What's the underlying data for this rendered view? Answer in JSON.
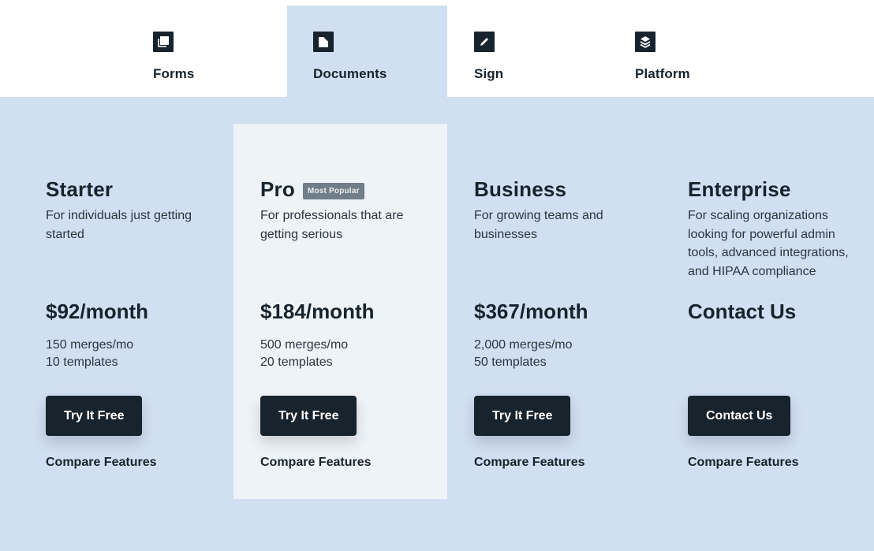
{
  "tabs": [
    {
      "label": "Forms",
      "icon": "forms-icon",
      "active": false
    },
    {
      "label": "Documents",
      "icon": "documents-icon",
      "active": true
    },
    {
      "label": "Sign",
      "icon": "sign-pencil-icon",
      "active": false
    },
    {
      "label": "Platform",
      "icon": "platform-layers-icon",
      "active": false
    }
  ],
  "colors": {
    "primary_dark": "#17232d",
    "page_background": "#d0dff1",
    "highlight_card": "#eef3f8",
    "badge_background": "#6f7e89"
  },
  "plans": [
    {
      "name": "Starter",
      "description": "For individuals just getting started",
      "price": "$92/month",
      "limits": [
        "150 merges/mo",
        "10 templates"
      ],
      "cta": "Try It Free",
      "compare": "Compare Features"
    },
    {
      "name": "Pro",
      "badge": "Most Popular",
      "description": "For professionals that are getting serious",
      "price": "$184/month",
      "limits": [
        "500 merges/mo",
        "20 templates"
      ],
      "cta": "Try It Free",
      "compare": "Compare Features"
    },
    {
      "name": "Business",
      "description": "For growing teams and businesses",
      "price": "$367/month",
      "limits": [
        "2,000 merges/mo",
        "50 templates"
      ],
      "cta": "Try It Free",
      "compare": "Compare Features"
    },
    {
      "name": "Enterprise",
      "description": "For scaling organizations looking for powerful admin tools, advanced integrations, and HIPAA compliance",
      "price": "Contact Us",
      "limits": [],
      "cta": "Contact Us",
      "compare": "Compare Features"
    }
  ]
}
